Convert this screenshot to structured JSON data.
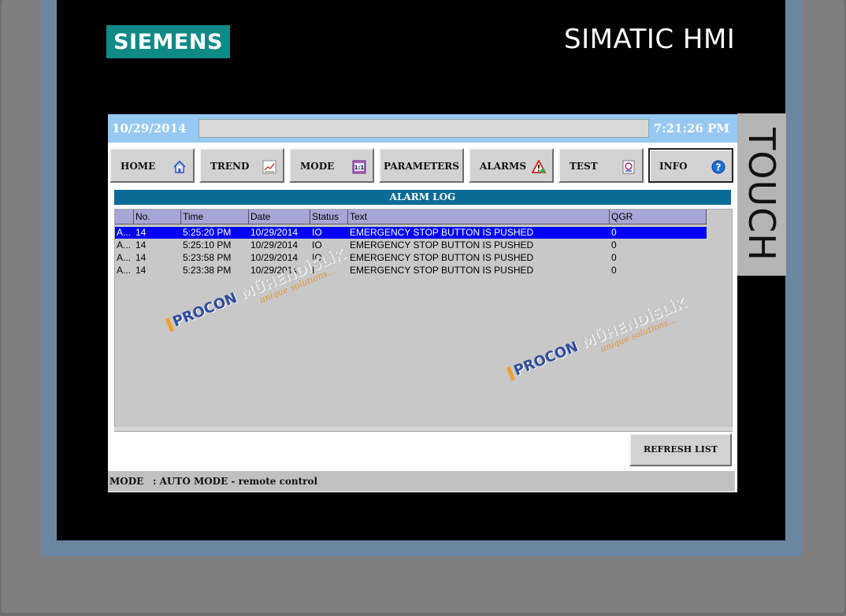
{
  "device": {
    "brand": "SIEMENS",
    "model": "SIMATIC HMI",
    "side_label": "TOUCH",
    "colors": {
      "brand": "#0f8a87",
      "bezel": "#6b86a0"
    }
  },
  "header": {
    "date": "10/29/2014",
    "message": "",
    "time": "7:21:26 PM",
    "bar_color": "#97c8f2"
  },
  "nav": [
    {
      "label": "HOME",
      "icon": "home-icon"
    },
    {
      "label": "TREND",
      "icon": "trend-icon"
    },
    {
      "label": "MODE",
      "icon": "mode-icon"
    },
    {
      "label": "PARAMETERS",
      "icon": ""
    },
    {
      "label": "ALARMS",
      "icon": "alarm-icon"
    },
    {
      "label": "TEST",
      "icon": "test-icon"
    },
    {
      "label": "INFO",
      "icon": "info-icon"
    }
  ],
  "alarm_log": {
    "title": "ALARM LOG",
    "columns": [
      "",
      "No.",
      "Time",
      "Date",
      "Status",
      "Text",
      "QGR"
    ],
    "rows": [
      {
        "flag": "A...",
        "no": "14",
        "time": "5:25:20 PM",
        "date": "10/29/2014",
        "status": "IO",
        "text": "EMERGENCY STOP BUTTON IS PUSHED",
        "qgr": "0",
        "selected": true
      },
      {
        "flag": "A...",
        "no": "14",
        "time": "5:25:10 PM",
        "date": "10/29/2014",
        "status": "IO",
        "text": "EMERGENCY STOP BUTTON IS PUSHED",
        "qgr": "0",
        "selected": false
      },
      {
        "flag": "A...",
        "no": "14",
        "time": "5:23:58 PM",
        "date": "10/29/2014",
        "status": "IO",
        "text": "EMERGENCY STOP BUTTON IS PUSHED",
        "qgr": "0",
        "selected": false
      },
      {
        "flag": "A...",
        "no": "14",
        "time": "5:23:38 PM",
        "date": "10/29/2014",
        "status": "I",
        "text": "EMERGENCY STOP BUTTON IS PUSHED",
        "qgr": "0",
        "selected": false
      }
    ],
    "selected_color": "#0000ff",
    "header_color": "#a6a6d8"
  },
  "refresh_label": "REFRESH LIST",
  "mode_bar": {
    "key": "MODE",
    "value": ": AUTO MODE - remote control"
  },
  "watermark": {
    "main": "PROCON",
    "word": "MÜHENDİSLİK",
    "tagline": "unique solutions..."
  }
}
